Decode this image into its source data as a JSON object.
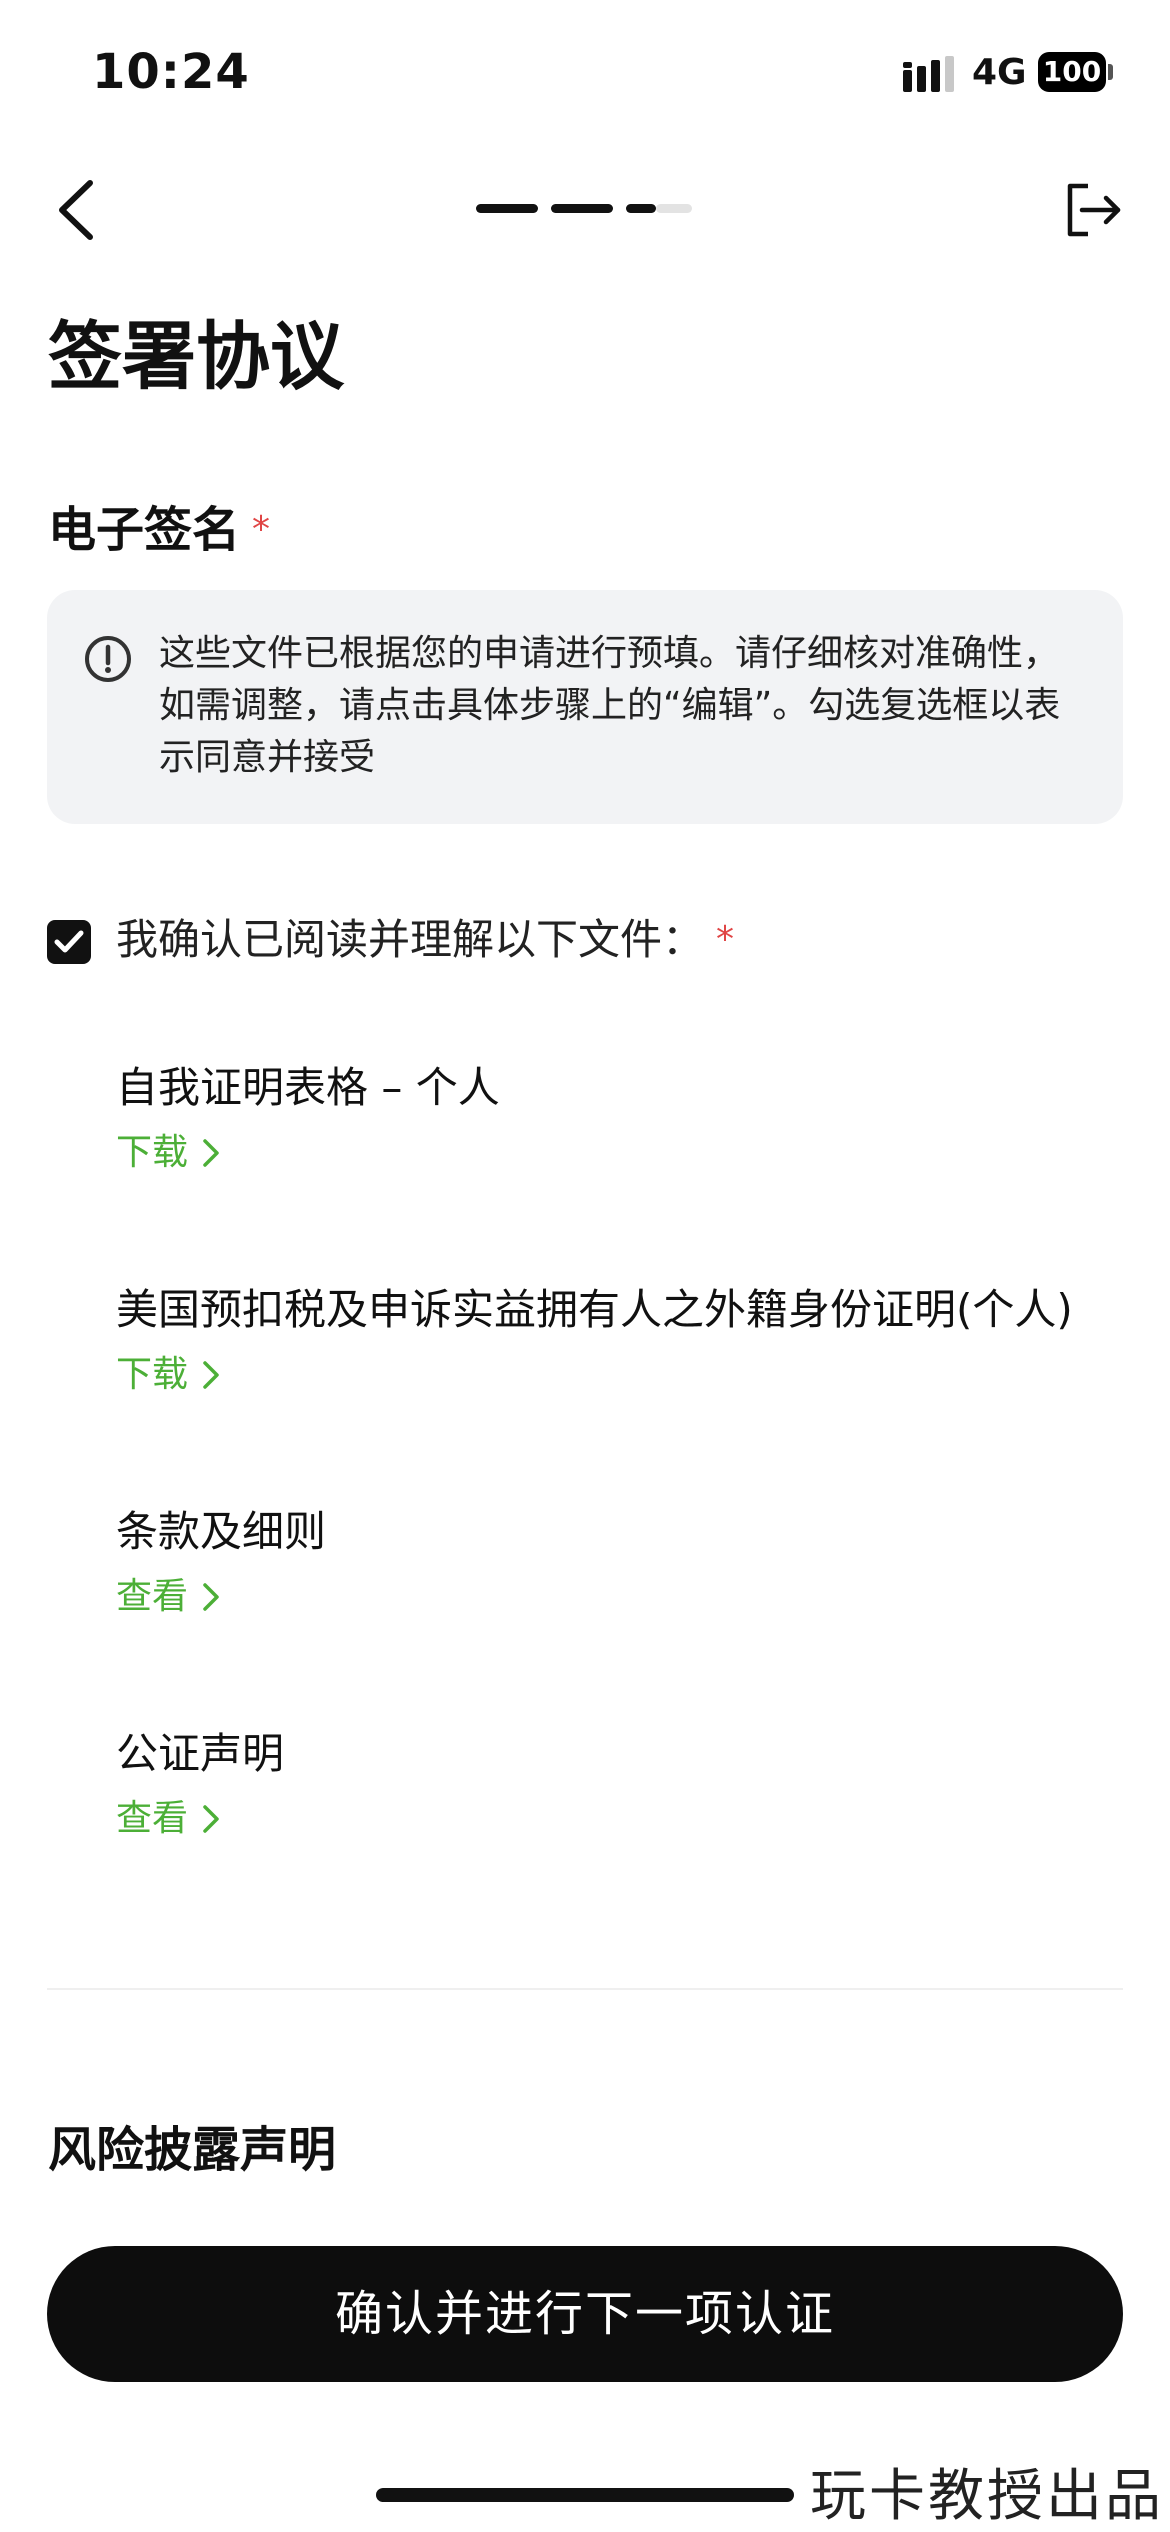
{
  "status_bar": {
    "time": "10:24",
    "network": "4G",
    "battery": "100"
  },
  "nav": {
    "back_icon": "chevron-left-icon",
    "exit_icon": "exit-icon",
    "progress_steps_total": 4,
    "progress_steps_done": 3
  },
  "page": {
    "title": "签署协议"
  },
  "signature_section": {
    "title": "电子签名",
    "required_marker": "*",
    "notice": "这些文件已根据您的申请进行预填。请仔细核对准确性，如需调整，请点击具体步骤上的“编辑”。勾选复选框以表示同意并接受",
    "confirm_label": "我确认已阅读并理解以下文件：",
    "confirm_required_marker": "*",
    "confirm_checked": true
  },
  "documents": [
    {
      "title": "自我证明表格 – 个人",
      "action": "下载"
    },
    {
      "title": "美国预扣税及申诉实益拥有人之外籍身份证明(个人)",
      "action": "下载"
    },
    {
      "title": "条款及细则",
      "action": "查看"
    },
    {
      "title": "公证声明",
      "action": "查看"
    }
  ],
  "risk_section": {
    "title": "风险披露声明"
  },
  "primary_button": {
    "label": "确认并进行下一项认证"
  },
  "watermark": "玩卡教授出品",
  "colors": {
    "link_green": "#4caf37",
    "required_red": "#e04545",
    "button_bg": "#0d0d0d",
    "notice_bg": "#f2f3f5"
  }
}
